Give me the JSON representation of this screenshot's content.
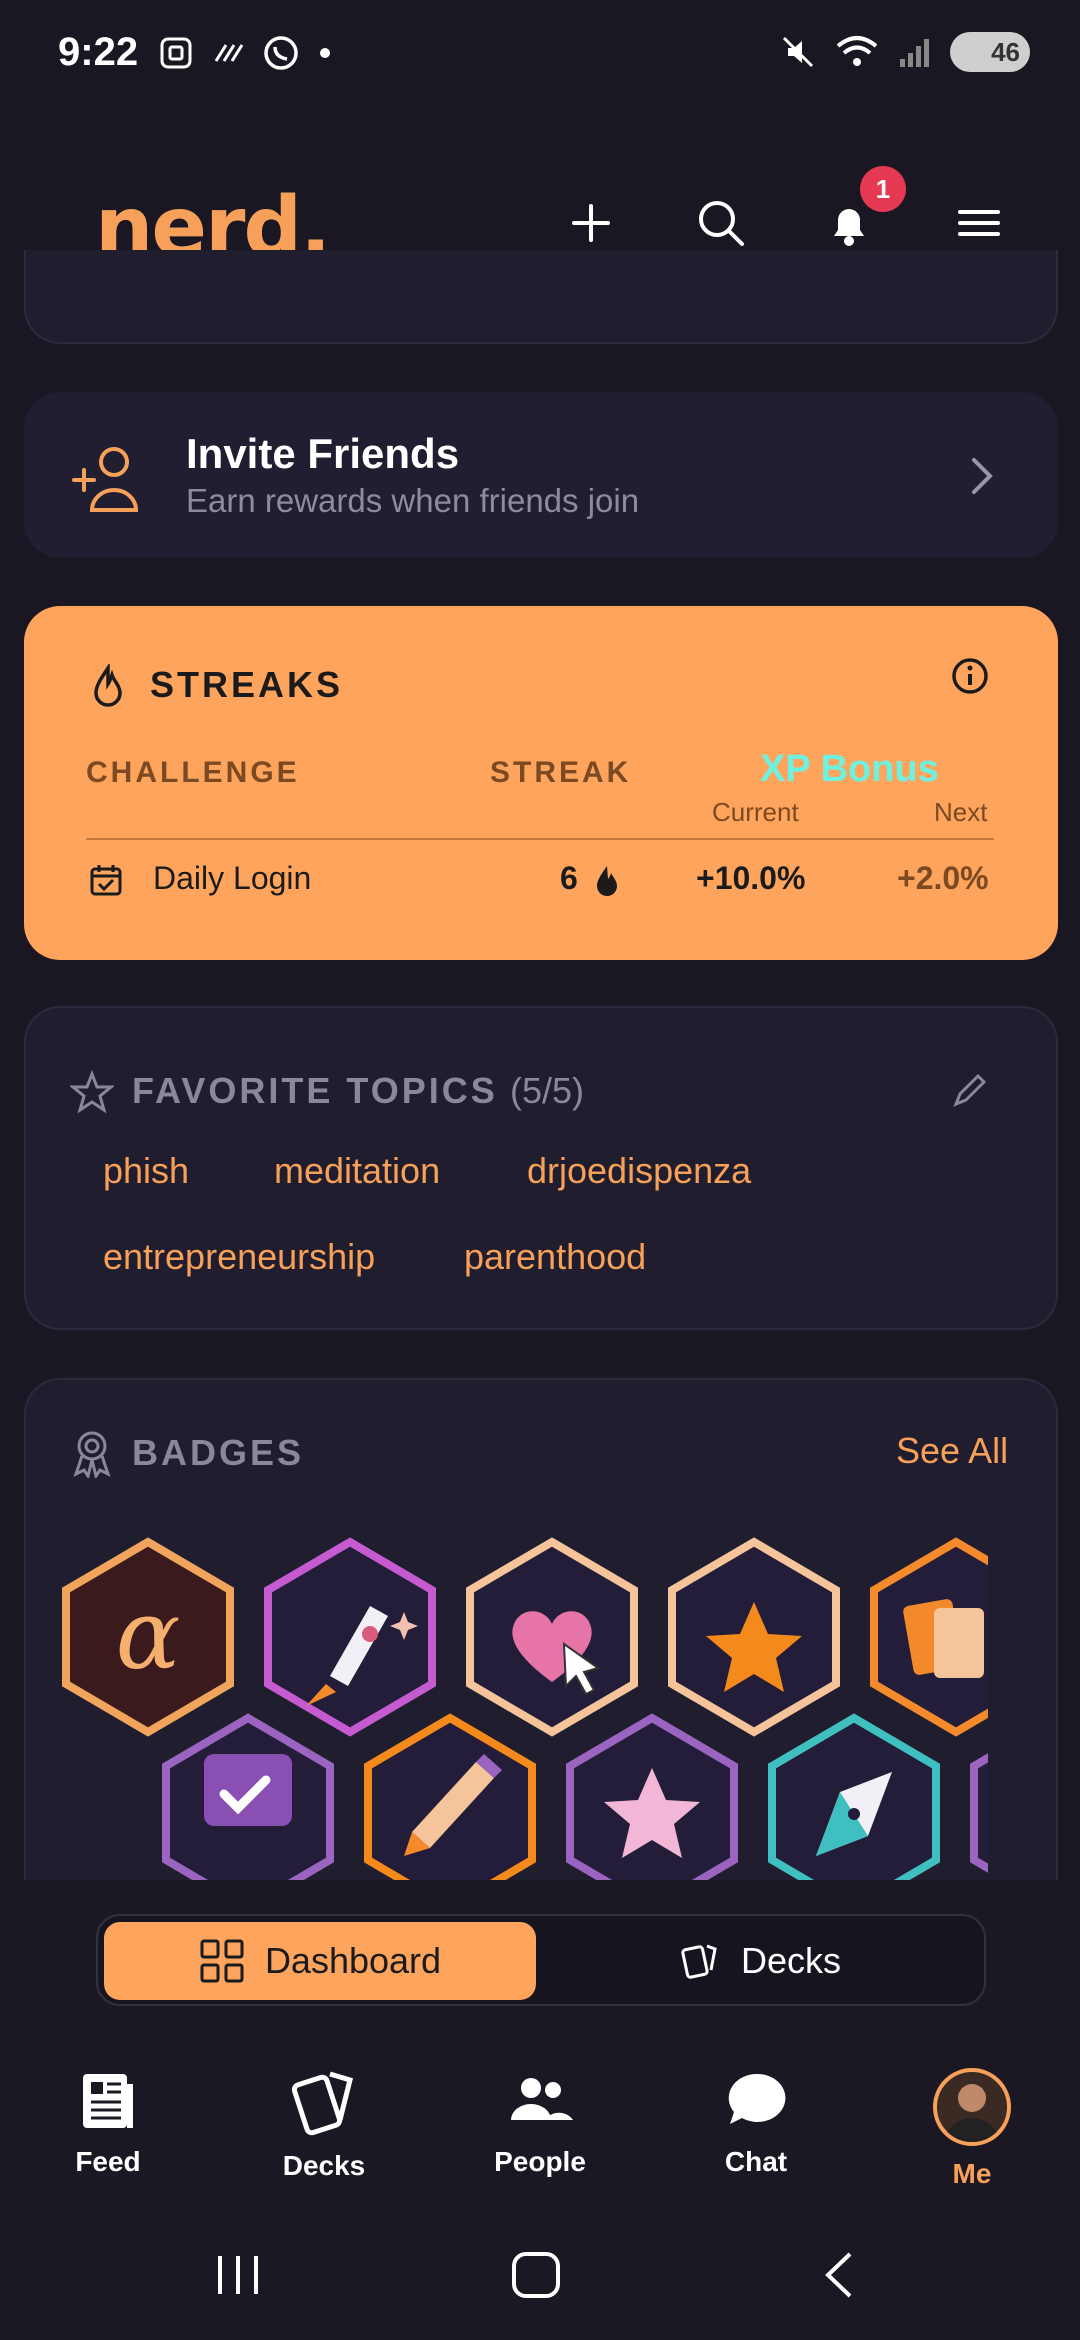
{
  "status_bar": {
    "time": "9:22",
    "battery": "46"
  },
  "header": {
    "logo": "nerd.",
    "notification_count": "1"
  },
  "invite": {
    "title": "Invite Friends",
    "subtitle": "Earn rewards when friends join"
  },
  "streaks": {
    "title": "STREAKS",
    "col_challenge": "CHALLENGE",
    "col_streak": "STREAK",
    "col_xp_bonus": "XP Bonus",
    "sub_current": "Current",
    "sub_next": "Next",
    "rows": [
      {
        "challenge": "Daily Login",
        "streak": "6",
        "current": "+10.0%",
        "next": "+2.0%"
      }
    ]
  },
  "favorite_topics": {
    "title": "FAVORITE TOPICS",
    "count": "(5/5)",
    "topics": [
      "phish",
      "meditation",
      "drjoedispenza",
      "entrepreneurship",
      "parenthood"
    ]
  },
  "badges": {
    "title": "BADGES",
    "see_all": "See All"
  },
  "segmented": {
    "dashboard": "Dashboard",
    "decks": "Decks"
  },
  "bottom_nav": {
    "feed": "Feed",
    "decks": "Decks",
    "people": "People",
    "chat": "Chat",
    "me": "Me"
  },
  "colors": {
    "accent": "#ffa45c",
    "background": "#1a1722",
    "card": "#1f1d2e",
    "cyan": "#6ff1e0",
    "badge_red": "#e53953"
  }
}
